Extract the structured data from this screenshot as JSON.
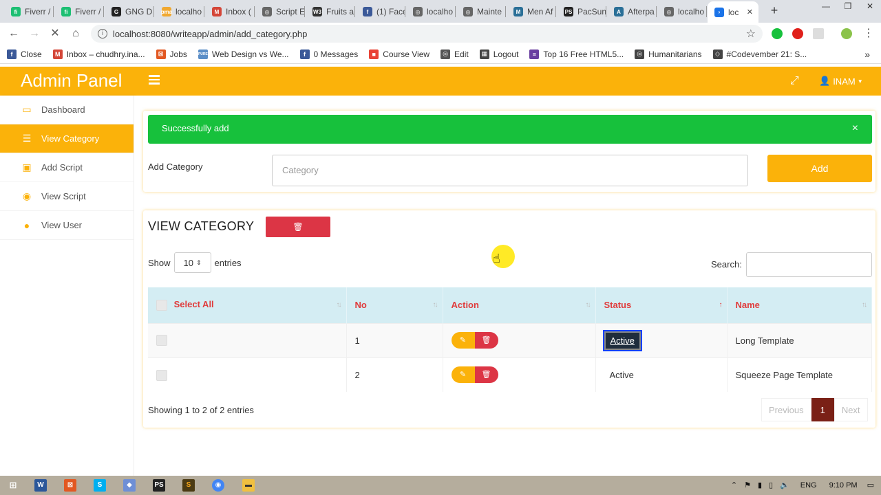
{
  "browser": {
    "tabs": [
      {
        "label": "Fiverr /",
        "color": "#1dbf73",
        "glyph": "fi"
      },
      {
        "label": "Fiverr /",
        "color": "#1dbf73",
        "glyph": "fi"
      },
      {
        "label": "GNG D",
        "color": "#222222",
        "glyph": "G"
      },
      {
        "label": "localho",
        "color": "#f0a830",
        "glyph": "pma"
      },
      {
        "label": "Inbox (",
        "color": "#d44638",
        "glyph": "M"
      },
      {
        "label": "Script E",
        "color": "#666666",
        "glyph": "◎"
      },
      {
        "label": "Fruits a",
        "color": "#333333",
        "glyph": "W3"
      },
      {
        "label": "(1) Face",
        "color": "#3b5998",
        "glyph": "f"
      },
      {
        "label": "localho",
        "color": "#666666",
        "glyph": "◎"
      },
      {
        "label": "Mainte",
        "color": "#666666",
        "glyph": "◎"
      },
      {
        "label": "Men Af",
        "color": "#2a6f97",
        "glyph": "M"
      },
      {
        "label": "PacSun",
        "color": "#222222",
        "glyph": "PS"
      },
      {
        "label": "Afterpa",
        "color": "#2a6f97",
        "glyph": "A"
      },
      {
        "label": "localho",
        "color": "#666666",
        "glyph": "◎"
      },
      {
        "label": "loc",
        "color": "#1a73e8",
        "glyph": "›"
      }
    ],
    "url": "localhost:8080/writeapp/admin/add_category.php",
    "bookmarks": [
      {
        "label": "Close",
        "color": "#3b5998",
        "glyph": "f"
      },
      {
        "label": "Inbox – chudhry.ina...",
        "color": "#d44638",
        "glyph": "M"
      },
      {
        "label": "Jobs",
        "color": "#e25822",
        "glyph": "⊠"
      },
      {
        "label": "Web Design vs We...",
        "color": "#5b8ec7",
        "glyph": "PURE"
      },
      {
        "label": "0 Messages",
        "color": "#3b5998",
        "glyph": "f"
      },
      {
        "label": "Course View",
        "color": "#e94235",
        "glyph": "■"
      },
      {
        "label": "Edit",
        "color": "#555555",
        "glyph": "◎"
      },
      {
        "label": "Logout",
        "color": "#444444",
        "glyph": "▦"
      },
      {
        "label": "Top 16 Free HTML5...",
        "color": "#6a3fa0",
        "glyph": "≡"
      },
      {
        "label": "Humanitarians",
        "color": "#444444",
        "glyph": "◎"
      },
      {
        "label": "#Codevember 21: S...",
        "color": "#444444",
        "glyph": "◇"
      }
    ]
  },
  "app": {
    "brand": "Admin Panel",
    "user": "INAM",
    "accent": "#fbb20a",
    "sidebar": [
      {
        "label": "Dashboard",
        "icon": "monitor-icon",
        "glyph": "▭",
        "active": false
      },
      {
        "label": "View Category",
        "icon": "list-icon",
        "glyph": "☰",
        "active": true
      },
      {
        "label": "Add Script",
        "icon": "save-icon",
        "glyph": "▣",
        "active": false
      },
      {
        "label": "View Script",
        "icon": "eye-icon",
        "glyph": "◉",
        "active": false
      },
      {
        "label": "View User",
        "icon": "user-icon",
        "glyph": "●",
        "active": false
      }
    ],
    "alert": {
      "text": "Successfully add",
      "close": "×"
    },
    "add_form": {
      "label": "Add Category",
      "placeholder": "Category",
      "button": "Add"
    },
    "list": {
      "title": "VIEW CATEGORY",
      "show_label": "Show",
      "entries_value": "10",
      "entries_label": "entries",
      "search_label": "Search:",
      "columns": [
        "Select All",
        "No",
        "Action",
        "Status",
        "Name"
      ],
      "rows": [
        {
          "no": "1",
          "status": "Active",
          "name": "Long Template"
        },
        {
          "no": "2",
          "status": "Active",
          "name": "Squeeze Page Template"
        }
      ],
      "footer": "Showing 1 to 2 of 2 entries",
      "pager": {
        "previous": "Previous",
        "current": "1",
        "next": "Next"
      }
    }
  },
  "taskbar": {
    "lang": "ENG",
    "time": "9:10 PM"
  }
}
